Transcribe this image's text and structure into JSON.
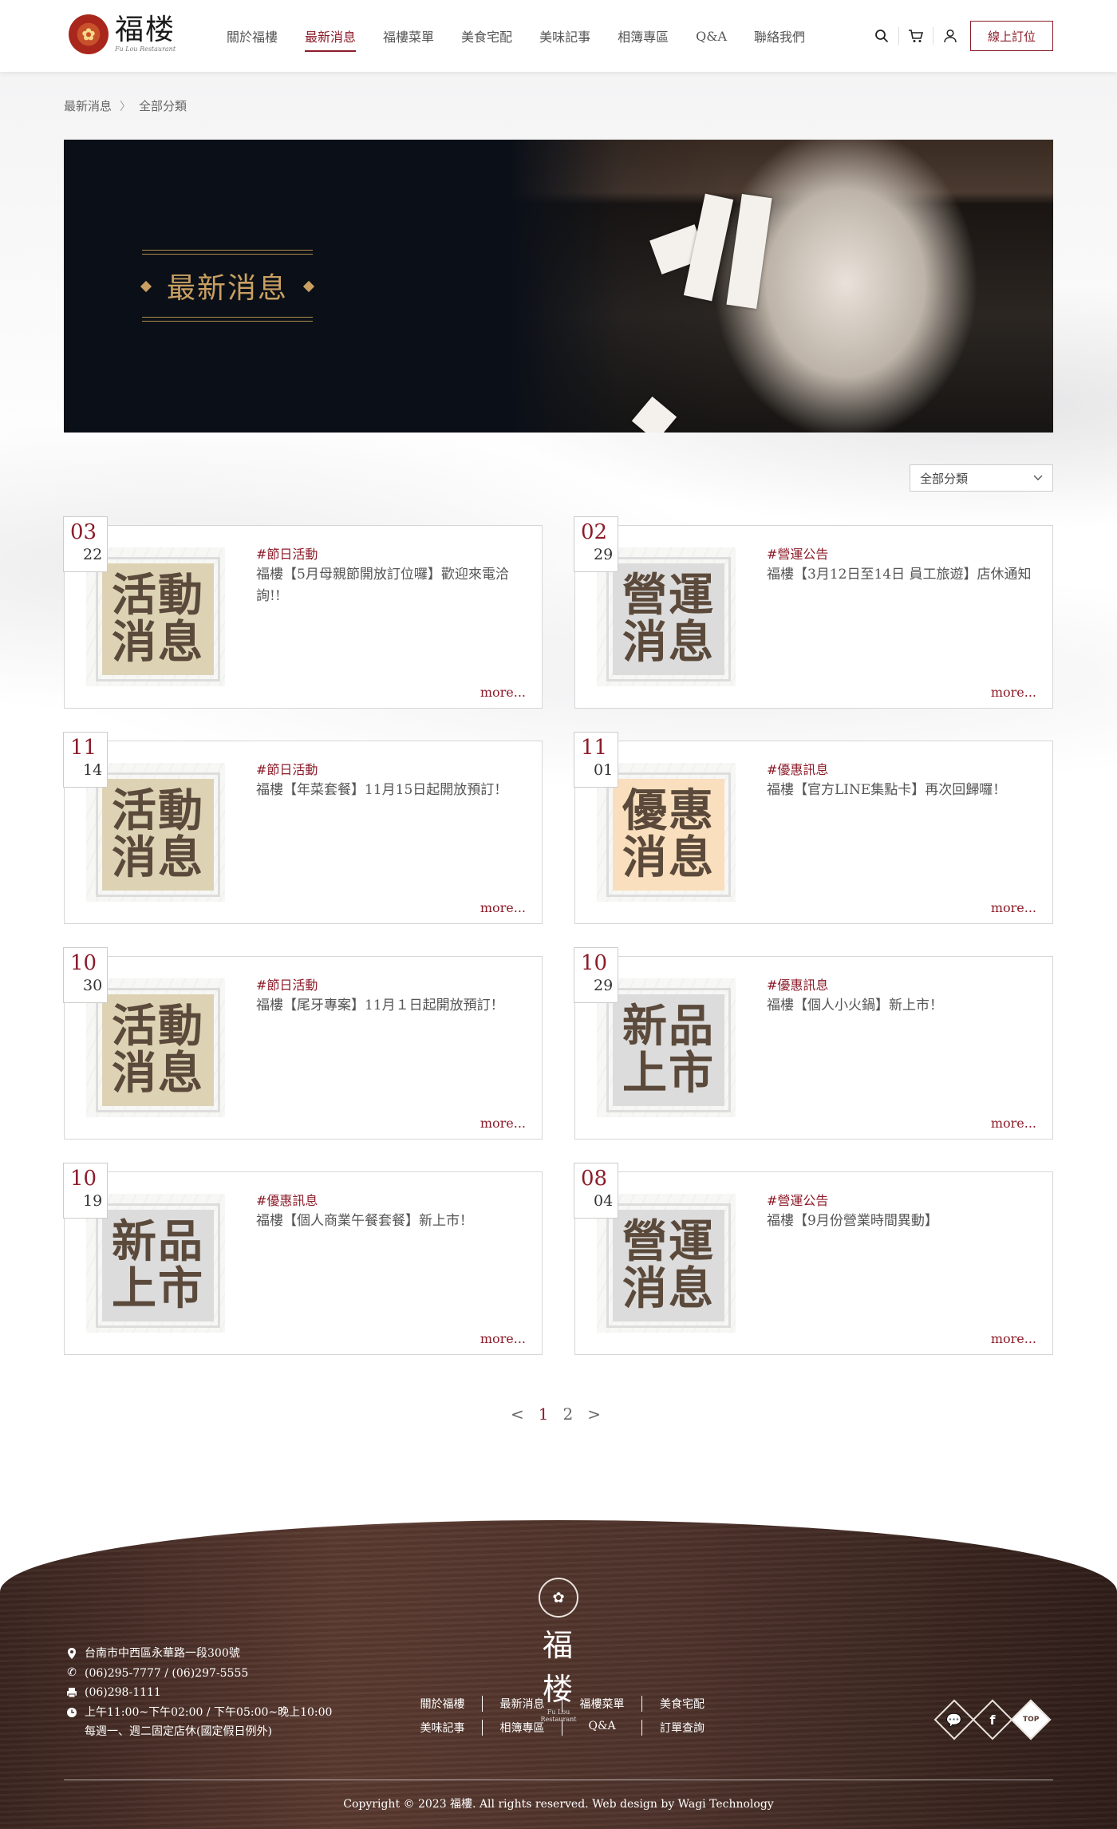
{
  "brand": {
    "name": "福楼",
    "subtitle": "Fu Lou Restaurant"
  },
  "nav": [
    {
      "label": "關於福樓",
      "active": false
    },
    {
      "label": "最新消息",
      "active": true
    },
    {
      "label": "福樓菜單",
      "active": false
    },
    {
      "label": "美食宅配",
      "active": false
    },
    {
      "label": "美味記事",
      "active": false
    },
    {
      "label": "相簿專區",
      "active": false
    },
    {
      "label": "Q&A",
      "active": false
    },
    {
      "label": "聯絡我們",
      "active": false
    }
  ],
  "header": {
    "reserve_label": "線上訂位"
  },
  "breadcrumb": [
    "最新消息",
    "全部分類"
  ],
  "banner": {
    "title": "最新消息"
  },
  "filter": {
    "selected": "全部分類"
  },
  "news": [
    {
      "month": "03",
      "day": "22",
      "category": "#節日活動",
      "title": "福樓【5月母親節開放訂位囉】歡迎來電洽詢!!",
      "thumb_line1": "活動",
      "thumb_line2": "消息",
      "thumb_color": "#ddd3b4",
      "more": "more..."
    },
    {
      "month": "02",
      "day": "29",
      "category": "#營運公告",
      "title": "福樓【3月12日至14日 員工旅遊】店休通知",
      "thumb_line1": "營運",
      "thumb_line2": "消息",
      "thumb_color": "#dcdcdc",
      "more": "more..."
    },
    {
      "month": "11",
      "day": "14",
      "category": "#節日活動",
      "title": "福樓【年菜套餐】11月15日起開放預訂！",
      "thumb_line1": "活動",
      "thumb_line2": "消息",
      "thumb_color": "#ddd3b4",
      "more": "more..."
    },
    {
      "month": "11",
      "day": "01",
      "category": "#優惠訊息",
      "title": "福樓【官方LINE集點卡】再次回歸囉！",
      "thumb_line1": "優惠",
      "thumb_line2": "消息",
      "thumb_color": "#f9dfbd",
      "more": "more..."
    },
    {
      "month": "10",
      "day": "30",
      "category": "#節日活動",
      "title": "福樓【尾牙專案】11月１日起開放預訂！",
      "thumb_line1": "活動",
      "thumb_line2": "消息",
      "thumb_color": "#ddd3b4",
      "more": "more..."
    },
    {
      "month": "10",
      "day": "29",
      "category": "#優惠訊息",
      "title": "福樓【個人小火鍋】新上市！",
      "thumb_line1": "新品",
      "thumb_line2": "上市",
      "thumb_color": "#dcdcdc",
      "more": "more..."
    },
    {
      "month": "10",
      "day": "19",
      "category": "#優惠訊息",
      "title": "福樓【個人商業午餐套餐】新上市！",
      "thumb_line1": "新品",
      "thumb_line2": "上市",
      "thumb_color": "#dcdcdc",
      "more": "more..."
    },
    {
      "month": "08",
      "day": "04",
      "category": "#營運公告",
      "title": "福樓【9月份營業時間異動】",
      "thumb_line1": "營運",
      "thumb_line2": "消息",
      "thumb_color": "#dcdcdc",
      "more": "more..."
    }
  ],
  "pagination": {
    "prev": "<",
    "pages": [
      "1",
      "2"
    ],
    "current": "1",
    "next": ">"
  },
  "footer": {
    "address": "台南市中西區永華路一段300號",
    "phone": "(06)295-7777 / (06)297-5555",
    "fax": "(06)298-1111",
    "hours": "上午11:00~下午02:00 / 下午05:00~晚上10:00",
    "closed": "每週一、週二固定店休(國定假日例外)",
    "links_row1": [
      "關於福樓",
      "最新消息",
      "福樓菜單",
      "美食宅配"
    ],
    "links_row2": [
      "美味記事",
      "相簿專區",
      "Q&A",
      "訂單查詢"
    ],
    "top_label": "TOP",
    "copyright": "Copyright © 2023 福樓. All rights reserved. Web design by Wagi Technology"
  },
  "colors": {
    "accent": "#8c1c2a",
    "gold": "#c9a062",
    "footer_bg": "#4e332b"
  }
}
